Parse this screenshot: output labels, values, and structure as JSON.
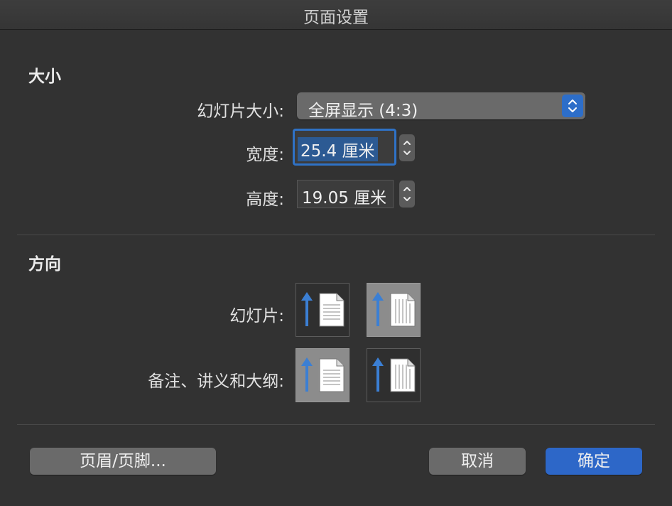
{
  "window": {
    "title": "页面设置"
  },
  "size_section": {
    "heading": "大小",
    "slide_size_label": "幻灯片大小:",
    "slide_size_value": "全屏显示 (4:3)",
    "width_label": "宽度:",
    "width_value": "25.4 厘米",
    "height_label": "高度:",
    "height_value": "19.05 厘米"
  },
  "orientation_section": {
    "heading": "方向",
    "slides_label": "幻灯片:",
    "notes_label": "备注、讲义和大纲:"
  },
  "buttons": {
    "header_footer": "页眉/页脚...",
    "cancel": "取消",
    "ok": "确定"
  },
  "colors": {
    "accent": "#2d67c8",
    "arrow": "#3b7fd4"
  }
}
